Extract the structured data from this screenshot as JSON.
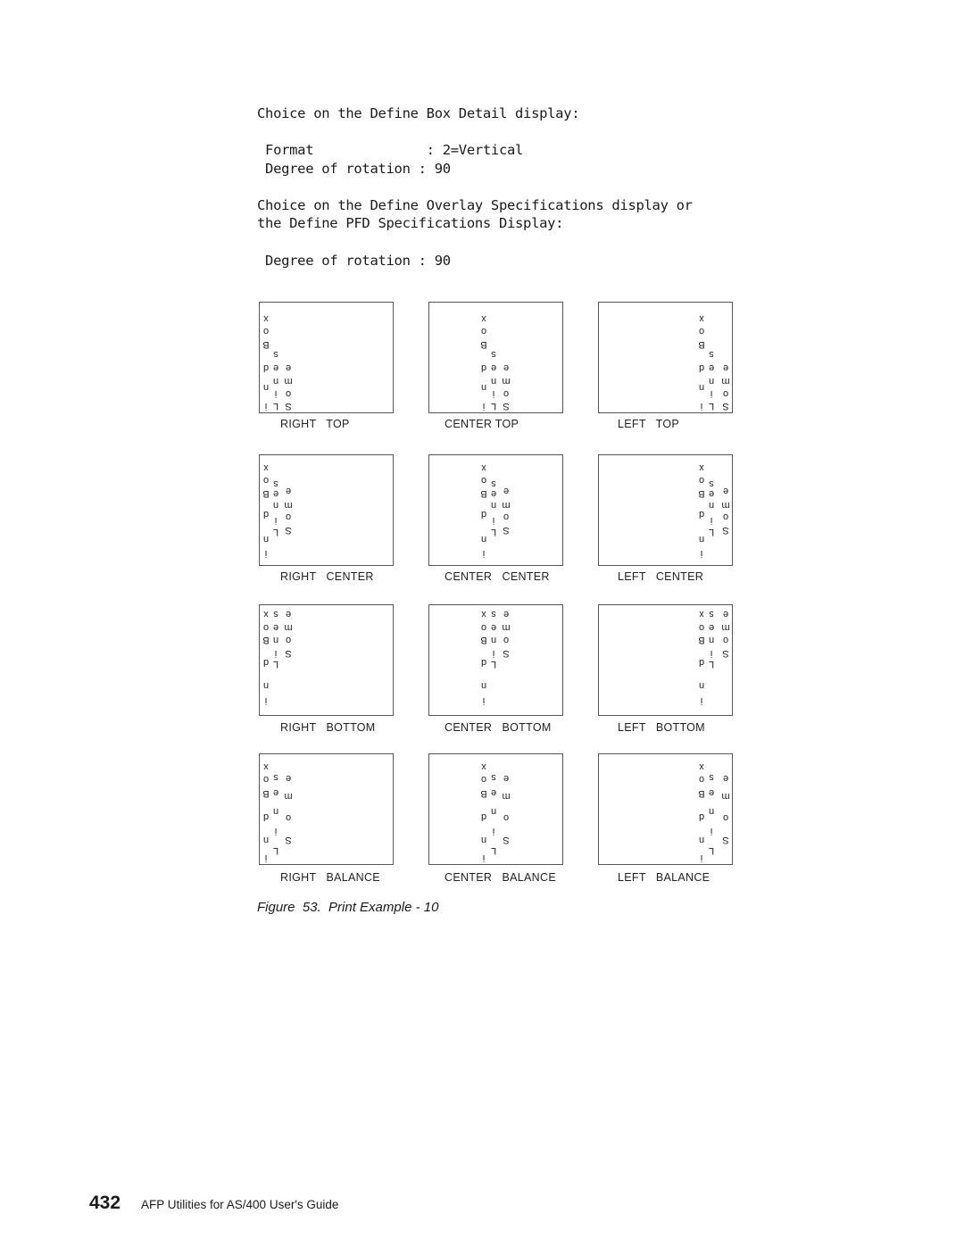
{
  "intro": {
    "line1": "Choice on the Define Box Detail display:",
    "format_line": " Format              : 2=Vertical",
    "rotation_line": " Degree of rotation : 90",
    "line2": "Choice on the Define Overlay Specifications display or",
    "line3": "the Define PFD Specifications Display:",
    "rotation_line2": " Degree of rotation : 90"
  },
  "glyph_columns": {
    "a": [
      "x",
      "o",
      "B",
      "d",
      "n",
      "i"
    ],
    "b": [
      "s",
      "e",
      "n",
      "i",
      "L"
    ],
    "c": [
      "e",
      "m",
      "o",
      "S"
    ]
  },
  "boxes": [
    {
      "label": "RIGHT   TOP",
      "horizontal": "right",
      "vertical": "top"
    },
    {
      "label": "CENTER TOP",
      "horizontal": "center",
      "vertical": "top"
    },
    {
      "label": "LEFT   TOP",
      "horizontal": "left",
      "vertical": "top"
    },
    {
      "label": "RIGHT   CENTER",
      "horizontal": "right",
      "vertical": "center"
    },
    {
      "label": "CENTER   CENTER",
      "horizontal": "center",
      "vertical": "center"
    },
    {
      "label": "LEFT   CENTER",
      "horizontal": "left",
      "vertical": "center"
    },
    {
      "label": "RIGHT   BOTTOM",
      "horizontal": "right",
      "vertical": "bottom"
    },
    {
      "label": "CENTER   BOTTOM",
      "horizontal": "center",
      "vertical": "bottom"
    },
    {
      "label": "LEFT   BOTTOM",
      "horizontal": "left",
      "vertical": "bottom"
    },
    {
      "label": "RIGHT   BALANCE",
      "horizontal": "right",
      "vertical": "balance"
    },
    {
      "label": "CENTER   BALANCE",
      "horizontal": "center",
      "vertical": "balance"
    },
    {
      "label": "LEFT   BALANCE",
      "horizontal": "left",
      "vertical": "balance"
    }
  ],
  "figure_caption": "Figure  53.  Print Example - 10",
  "footer": {
    "page_number": "432",
    "book_title": "AFP Utilities for AS/400 User's Guide"
  }
}
